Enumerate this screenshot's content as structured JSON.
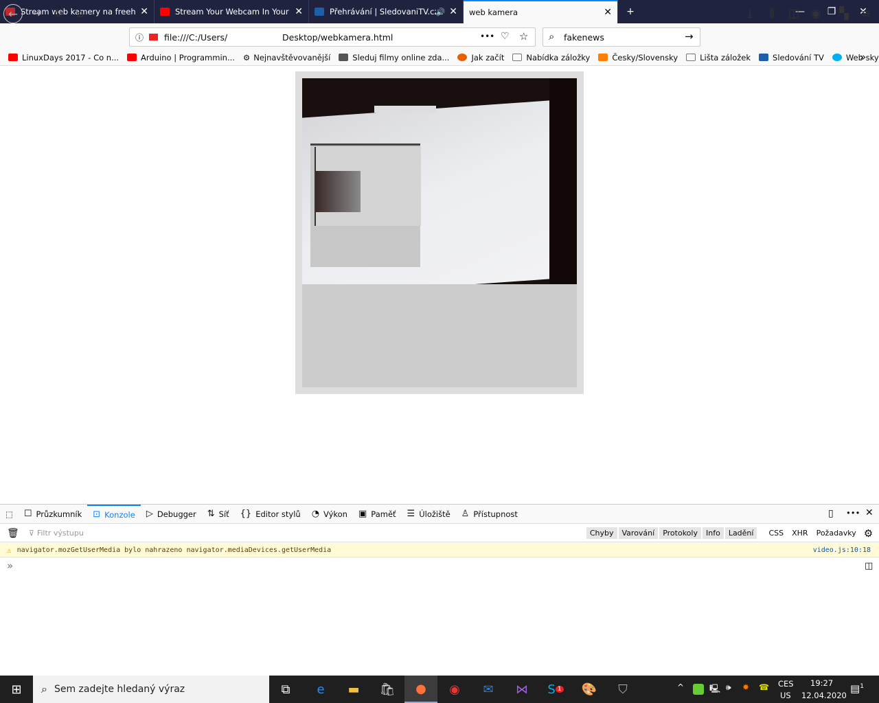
{
  "tabs": [
    {
      "title": "Stream web kamery na freehost",
      "favicon": "pnet-icon",
      "color": "#c1272d"
    },
    {
      "title": "Stream Your Webcam In Your B",
      "favicon": "youtube-icon",
      "color": "#ff0000"
    },
    {
      "title": "Přehrávání | SledovaniTV.cz",
      "favicon": "tv-icon",
      "color": "#1d5fa8",
      "audio": "🔊"
    },
    {
      "title": "web kamera",
      "active": true
    }
  ],
  "window": {
    "new_tab": "+",
    "minimize": "—",
    "restore": "❐",
    "close": "✕"
  },
  "nav": {
    "url": "file:///C:/Users/",
    "url_end": "Desktop/webkamera.html",
    "search_value": "fakenews",
    "more": "•••"
  },
  "bookmarks": [
    {
      "label": "LinuxDays 2017 - Co n...",
      "icon": "youtube-icon",
      "color": "#ff0000"
    },
    {
      "label": "Arduino | Programmin...",
      "icon": "youtube-icon",
      "color": "#ff0000"
    },
    {
      "label": "Nejnavštěvovanější",
      "icon": "gear-icon"
    },
    {
      "label": "Sleduj filmy online zda...",
      "icon": "film-icon",
      "color": "#555"
    },
    {
      "label": "Jak začít",
      "icon": "firefox-icon",
      "color": "#e66000"
    },
    {
      "label": "Nabídka záložky",
      "icon": "folder-icon"
    },
    {
      "label": "Česky/Slovensky",
      "icon": "star-icon",
      "color": "#ff7f00"
    },
    {
      "label": "Lišta záložek",
      "icon": "folder-icon"
    },
    {
      "label": "Sledování TV",
      "icon": "tv-icon",
      "color": "#1d5fa8"
    },
    {
      "label": "Web skype",
      "icon": "skype-icon",
      "color": "#00aff0"
    }
  ],
  "devtools": {
    "tabs": [
      {
        "label": "Průzkumník",
        "icon": "☐"
      },
      {
        "label": "Konzole",
        "icon": "⊡",
        "active": true
      },
      {
        "label": "Debugger",
        "icon": "▷"
      },
      {
        "label": "Síť",
        "icon": "⇅"
      },
      {
        "label": "Editor stylů",
        "icon": "{}"
      },
      {
        "label": "Výkon",
        "icon": "◔"
      },
      {
        "label": "Paměť",
        "icon": "▣"
      },
      {
        "label": "Úložiště",
        "icon": "☰"
      },
      {
        "label": "Přístupnost",
        "icon": "♙"
      }
    ],
    "filter_placeholder": "Filtr výstupu",
    "filters_on": [
      "Chyby",
      "Varování",
      "Protokoly",
      "Info",
      "Ladění"
    ],
    "filters_off": [
      "CSS",
      "XHR",
      "Požadavky"
    ],
    "message": "navigator.mozGetUserMedia bylo nahrazeno navigator.mediaDevices.getUserMedia",
    "message_source": "video.js:10:18",
    "prompt": "»"
  },
  "taskbar": {
    "search_placeholder": "Sem zadejte hledaný výraz",
    "lang_top": "CES",
    "lang_bottom": "US",
    "time": "19:27",
    "date": "12.04.2020",
    "notifications": "1",
    "skype_badge": "1"
  }
}
